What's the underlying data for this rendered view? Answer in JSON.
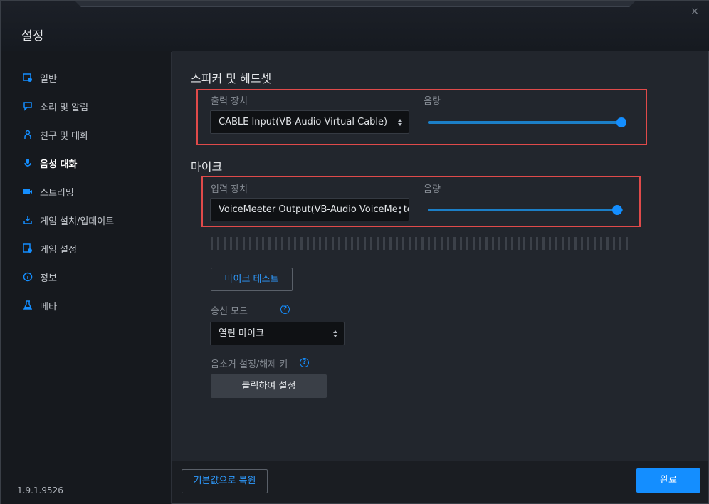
{
  "window": {
    "title": "설정",
    "close_symbol": "×"
  },
  "sidebar": {
    "items": [
      {
        "label": "일반",
        "icon": "gear-window-icon"
      },
      {
        "label": "소리 및 알림",
        "icon": "speech-bubble-icon"
      },
      {
        "label": "친구 및 대화",
        "icon": "person-icon"
      },
      {
        "label": "음성 대화",
        "icon": "microphone-icon",
        "active": true
      },
      {
        "label": "스트리밍",
        "icon": "video-camera-icon"
      },
      {
        "label": "게임 설치/업데이트",
        "icon": "download-icon"
      },
      {
        "label": "게임 설정",
        "icon": "gear-document-icon"
      },
      {
        "label": "정보",
        "icon": "info-icon"
      },
      {
        "label": "베타",
        "icon": "flask-icon"
      }
    ],
    "version": "1.9.1.9526"
  },
  "speakers": {
    "title": "스피커 및 헤드셋",
    "device_label": "출력 장치",
    "device_value": "CABLE Input(VB-Audio Virtual Cable)",
    "volume_label": "음량",
    "volume_level": 0.98
  },
  "microphone": {
    "title": "마이크",
    "device_label": "입력 장치",
    "device_value": "VoiceMeeter Output(VB-Audio VoiceMeeter VAIO)",
    "volume_label": "음량",
    "volume_level": 0.97,
    "test_button": "마이크 테스트",
    "transmit_mode_label": "송신 모드",
    "transmit_mode_value": "열린 마이크",
    "mute_key_label": "음소거 설정/해제 키",
    "mute_key_button": "클릭하여 설정"
  },
  "footer": {
    "reset_button": "기본값으로 복원",
    "done_button": "완료"
  },
  "colors": {
    "accent": "#148eff",
    "highlight": "#e04a4a",
    "background": "#22262d"
  }
}
